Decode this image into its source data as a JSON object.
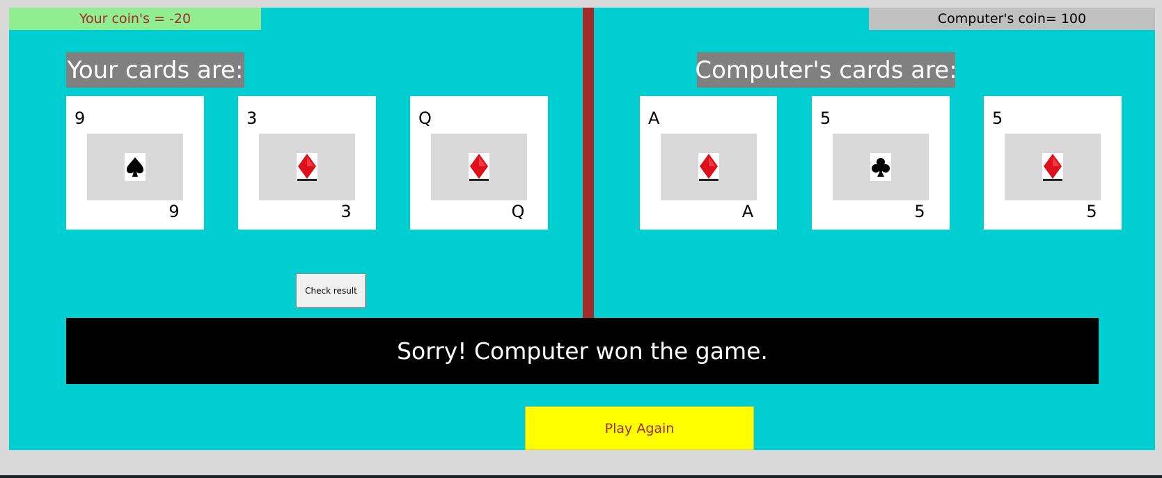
{
  "user": {
    "coin_text": "Your coin's = -20",
    "heading": "Your cards are:",
    "cards": [
      {
        "rank": "9",
        "suit": "spade"
      },
      {
        "rank": "3",
        "suit": "diamond"
      },
      {
        "rank": "Q",
        "suit": "diamond"
      }
    ]
  },
  "computer": {
    "coin_text": "Computer's coin= 100",
    "heading": "Computer's cards are:",
    "cards": [
      {
        "rank": "A",
        "suit": "diamond"
      },
      {
        "rank": "5",
        "suit": "club"
      },
      {
        "rank": "5",
        "suit": "diamond"
      }
    ]
  },
  "controls": {
    "check_label": "Check result",
    "play_again_label": "Play Again"
  },
  "result_message": "Sorry! Computer won the game.",
  "colors": {
    "table": "#00ced1",
    "divider": "#a52a2a",
    "user_coin_bg": "#90ee90",
    "computer_coin_bg": "#c0c0c0",
    "heading_bg": "#808080",
    "result_bg": "#000000",
    "play_again_bg": "#ffff00",
    "diamond_red": "#e0101a"
  }
}
